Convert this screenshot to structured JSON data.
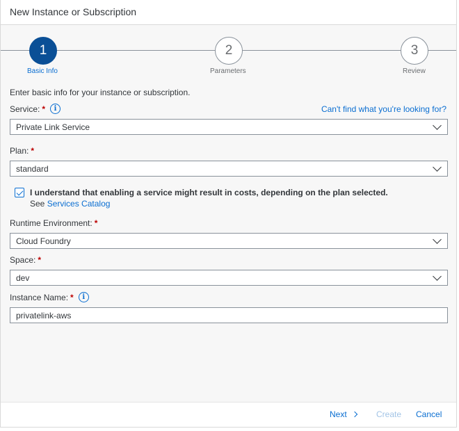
{
  "dialog": {
    "title": "New Instance or Subscription"
  },
  "wizard": {
    "steps": [
      {
        "number": "1",
        "label": "Basic Info",
        "active": true
      },
      {
        "number": "2",
        "label": "Parameters",
        "active": false
      },
      {
        "number": "3",
        "label": "Review",
        "active": false
      }
    ]
  },
  "form": {
    "intro": "Enter basic info for your instance or subscription.",
    "help_link": "Can't find what you're looking for?",
    "service": {
      "label": "Service:",
      "required": "*",
      "value": "Private Link Service"
    },
    "plan": {
      "label": "Plan:",
      "required": "*",
      "value": "standard"
    },
    "consent": {
      "text": "I understand that enabling a service might result in costs, depending on the plan selected.",
      "see": "See",
      "link": "Services Catalog",
      "checked": true
    },
    "runtime": {
      "label": "Runtime Environment:",
      "required": "*",
      "value": "Cloud Foundry"
    },
    "space": {
      "label": "Space:",
      "required": "*",
      "value": "dev"
    },
    "instance_name": {
      "label": "Instance Name:",
      "required": "*",
      "value": "privatelink-aws"
    }
  },
  "footer": {
    "next": "Next",
    "create": "Create",
    "cancel": "Cancel"
  },
  "icons": {
    "info": "info-icon",
    "dropdown": "chevron-down-icon",
    "next": "chevron-right-icon",
    "check": "checkmark-icon"
  },
  "colors": {
    "accent": "#0a6ed1",
    "active_step": "#0a4f96",
    "required": "#bb0000"
  }
}
